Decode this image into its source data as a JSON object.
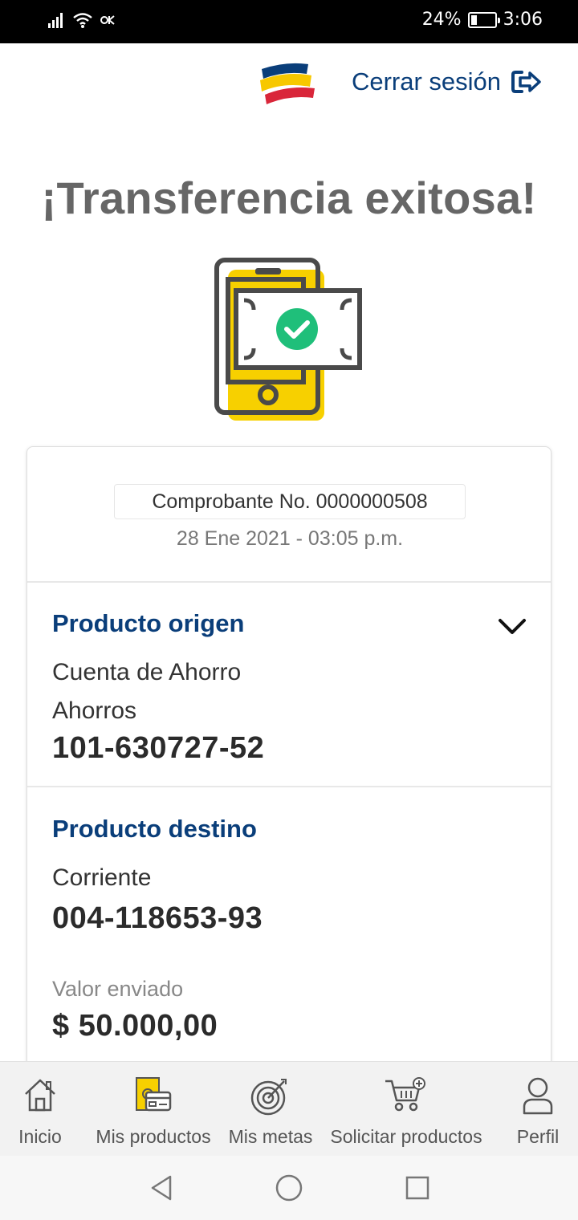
{
  "status_bar": {
    "battery_text": "24%",
    "battery_level": 0.24,
    "time": "3:06"
  },
  "header": {
    "logout_label": "Cerrar sesión",
    "logo_colors": [
      "#f7c800",
      "#0a3e7a",
      "#d9263a"
    ]
  },
  "title": "¡Transferencia exitosa!",
  "receipt": {
    "voucher": "Comprobante No. 0000000508",
    "datetime": "28 Ene 2021 - 03:05 p.m."
  },
  "origin": {
    "title": "Producto origen",
    "line1": "Cuenta de Ahorro",
    "line2": "Ahorros",
    "number": "101-630727-52"
  },
  "destination": {
    "title": "Producto destino",
    "line1": "Corriente",
    "number": "004-118653-93"
  },
  "amount": {
    "label": "Valor enviado",
    "value": "$ 50.000,00"
  },
  "nav": {
    "items": [
      {
        "label": "Inicio",
        "icon": "home-icon"
      },
      {
        "label": "Mis productos",
        "icon": "products-icon"
      },
      {
        "label": "Mis metas",
        "icon": "target-icon"
      },
      {
        "label": "Solicitar productos",
        "icon": "cart-add-icon"
      },
      {
        "label": "Perfil",
        "icon": "user-icon"
      }
    ]
  },
  "colors": {
    "brand_blue": "#0a3e7a",
    "accent_yellow": "#f7d000",
    "success_green": "#1fbf7a",
    "title_grey": "#666666"
  }
}
